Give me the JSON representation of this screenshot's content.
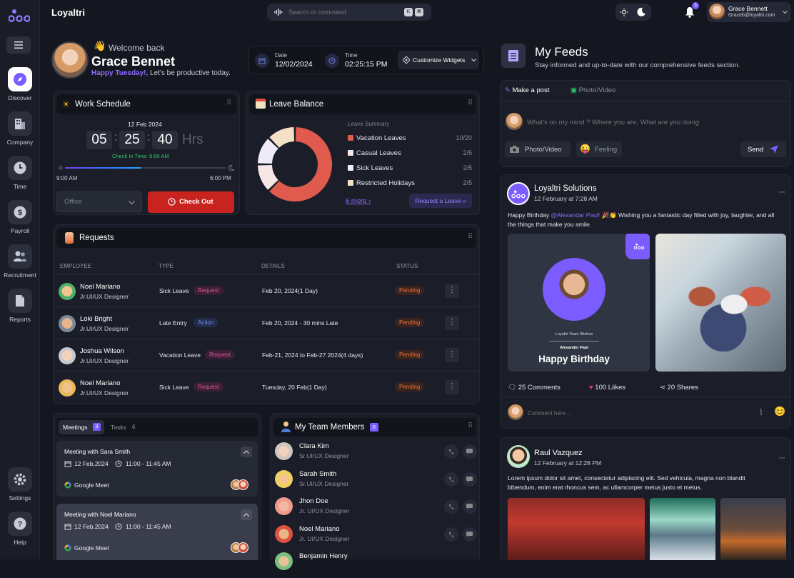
{
  "app": {
    "name": "Loyaltri"
  },
  "search": {
    "placeholder": "Search or command",
    "key1": "K",
    "key2": "⌘"
  },
  "user": {
    "name": "Grace Bennett",
    "email": "Graceb@loyaltri.com",
    "notifications": "3"
  },
  "sidebar": {
    "items": [
      {
        "label": "Discover"
      },
      {
        "label": "Company"
      },
      {
        "label": "Time"
      },
      {
        "label": "Payroll"
      },
      {
        "label": "Recruitment"
      },
      {
        "label": "Reports"
      },
      {
        "label": "Settings"
      },
      {
        "label": "Help"
      }
    ]
  },
  "welcome": {
    "greeting": "Welcome back",
    "emoji": "👋",
    "name": "Grace Bennet",
    "highlight": "Happy Tuesday!,",
    "subtitle": " Let's be productive today."
  },
  "datetime": {
    "date_label": "Date",
    "date": "12/02/2024",
    "time_label": "Time",
    "time": "02:25:15 PM",
    "customize": "Customize Widgets"
  },
  "schedule": {
    "title": "Work Schedule",
    "date": "12 Feb 2024",
    "h": "05",
    "m": "25",
    "s": "40",
    "unit": "Hrs",
    "checkin": "Check In Time: 8:50 AM",
    "progress": 0.47,
    "start": "9:00 AM",
    "end": "6:00 PM",
    "location": "Office",
    "checkout": "Check Out"
  },
  "leave": {
    "title": "Leave Balance",
    "summary": "Leave Summary",
    "items": [
      {
        "label": "Vacation Leaves",
        "value": "10/20",
        "color": "#e05a4e"
      },
      {
        "label": "Casual Leaves",
        "value": "2/5",
        "color": "#f6e6e6"
      },
      {
        "label": "Sick Leaves",
        "value": "2/5",
        "color": "#efeaf7"
      },
      {
        "label": "Restricted Holidays",
        "value": "2/5",
        "color": "#f4e0c4"
      }
    ],
    "more": "6 more",
    "request": "Request a Leave"
  },
  "requests": {
    "title": "Requests",
    "headers": [
      "EMPLOYEE",
      "TYPE",
      "DETAILS",
      "STATUS"
    ],
    "rows": [
      {
        "name": "Noel Mariano",
        "role": "Jr.UI/UX Designer",
        "type": "Sick Leave",
        "tag": "Request",
        "details": "Feb 20, 2024(1 Day)",
        "status": "Pending"
      },
      {
        "name": "Loki Bright",
        "role": "Jr.UI/UX Designer",
        "type": "Late Entry",
        "tag": "Action",
        "details": "Feb 20, 2024 - 30 mins Late",
        "status": "Pending"
      },
      {
        "name": "Joshua Wilson",
        "role": "Jr.UI/UX Designer",
        "type": "Vacation Leave",
        "tag": "Request",
        "details": "Feb-21, 2024 to Feb-27 2024(4 days)",
        "status": "Pending"
      },
      {
        "name": "Noel Mariano",
        "role": "Jr.UI/UX Designer",
        "type": "Sick Leave",
        "tag": "Request",
        "details": "Tuesday, 20 Feb(1 Day)",
        "status": "Pending"
      }
    ]
  },
  "meetings": {
    "tab_meetings": "Meetings",
    "meetings_count": "3",
    "tab_tasks": "Tasks",
    "tasks_count": "6",
    "items": [
      {
        "title": "Meeting with Sara Smith",
        "date": "12 Feb,2024",
        "time": "11:00 - 11:45 AM",
        "platform": "Google Meet"
      },
      {
        "title": "Meeting with Noel Mariano",
        "date": "12 Feb,2024",
        "time": "11:00 - 11:45 AM",
        "platform": "Google Meet"
      }
    ]
  },
  "team": {
    "title": "My Team Members",
    "count": "6",
    "members": [
      {
        "name": "Clara Kim",
        "role": "Sr.UI/UX Designer"
      },
      {
        "name": "Sarah Smith",
        "role": "Sr.UI/UX Designer"
      },
      {
        "name": "Jhon Doe",
        "role": "Jr. UI/UX Designer"
      },
      {
        "name": "Noel Mariano",
        "role": "Jr. UI/UX Designer"
      },
      {
        "name": "Benjamin Henry",
        "role": ""
      }
    ]
  },
  "feeds": {
    "title": "My Feeds",
    "subtitle": "Stay informed and up-to-date with our comprehensive feeds section.",
    "make_post": "Make a post",
    "photo_video_tab": "Photo/Video",
    "placeholder": "What's on my mind ? Where you are, What are you doing",
    "photo_video": "Photo/Video",
    "feeling": "Feeling",
    "send": "Send"
  },
  "post1": {
    "author": "Loyaltri Solutions",
    "time": "12 February at 7:28 AM",
    "text_pre": "Happy Birthday ",
    "mention": "@Alexandar Paul!",
    "text_post": " 🎉👏 Wishing you a fantastic day filled with joy, laughter, and all the things that make you smile.",
    "card_caption": "Loyaltri Team Wishes",
    "card_name": "Alexander Paul",
    "card_title": "Happy Birthday",
    "comments": "25 Comments",
    "likes": "100 Liikes",
    "shares": "20 Shares",
    "comment_placeholder": "Comment here..."
  },
  "post2": {
    "author": "Raul Vazquez",
    "time": "12 February at 12:28 PM",
    "text": "Lorem ipsum dolor sit amet, consectetur adipiscing elit. Sed vehicula, magna non blandit bibendum, enim erat rhoncus sem, ac ullamcorper metus justo et metus."
  },
  "colors": {
    "accent": "#7b5cff",
    "danger": "#c8231f",
    "bg": "#14171f",
    "panel": "#1b1e28"
  }
}
